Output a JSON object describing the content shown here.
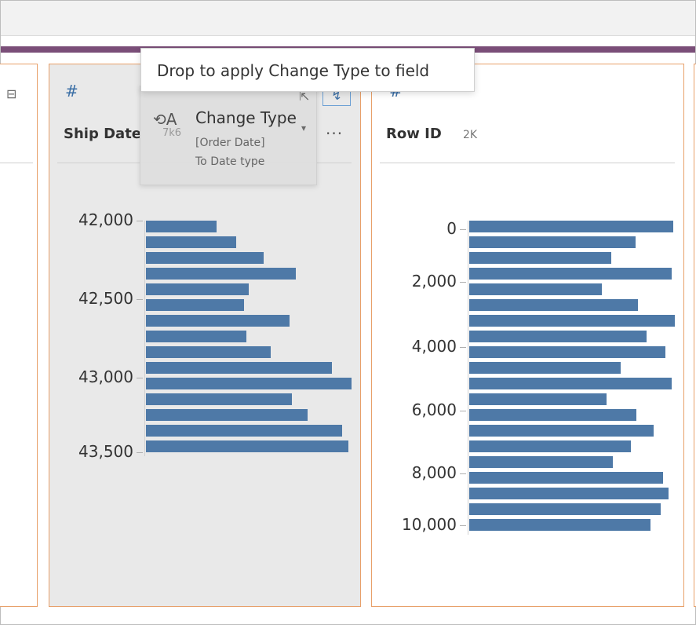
{
  "tooltip": {
    "text": "Drop to apply Change Type to field"
  },
  "drag_card": {
    "title": "Change Type",
    "field": "[Order Date]",
    "target": "To Date type",
    "count": "7k6"
  },
  "cards": {
    "ship_date": {
      "type_icon": "#",
      "title": "Ship Date",
      "more_label": "···"
    },
    "row_id": {
      "type_icon": "#",
      "title": "Row ID",
      "count": "2K"
    }
  },
  "chart_data": [
    {
      "type": "bar",
      "orientation": "horizontal",
      "title": "Ship Date",
      "y_ticks": [
        "42,000",
        "42,500",
        "43,000",
        "43,500"
      ],
      "values": [
        90,
        115,
        150,
        191,
        131,
        125,
        183,
        128,
        159,
        237,
        262,
        186,
        206,
        250,
        258
      ]
    },
    {
      "type": "bar",
      "orientation": "horizontal",
      "title": "Row ID",
      "y_ticks": [
        "0",
        "2,000",
        "4,000",
        "6,000",
        "8,000",
        "10,000"
      ],
      "values": [
        260,
        212,
        181,
        258,
        169,
        215,
        262,
        226,
        250,
        193,
        258,
        175,
        213,
        235,
        206,
        183,
        247,
        254,
        244,
        231
      ]
    }
  ],
  "colors": {
    "bar": "#4e79a7",
    "accent_border": "#e8a06a",
    "header_band": "#7a4e78"
  }
}
